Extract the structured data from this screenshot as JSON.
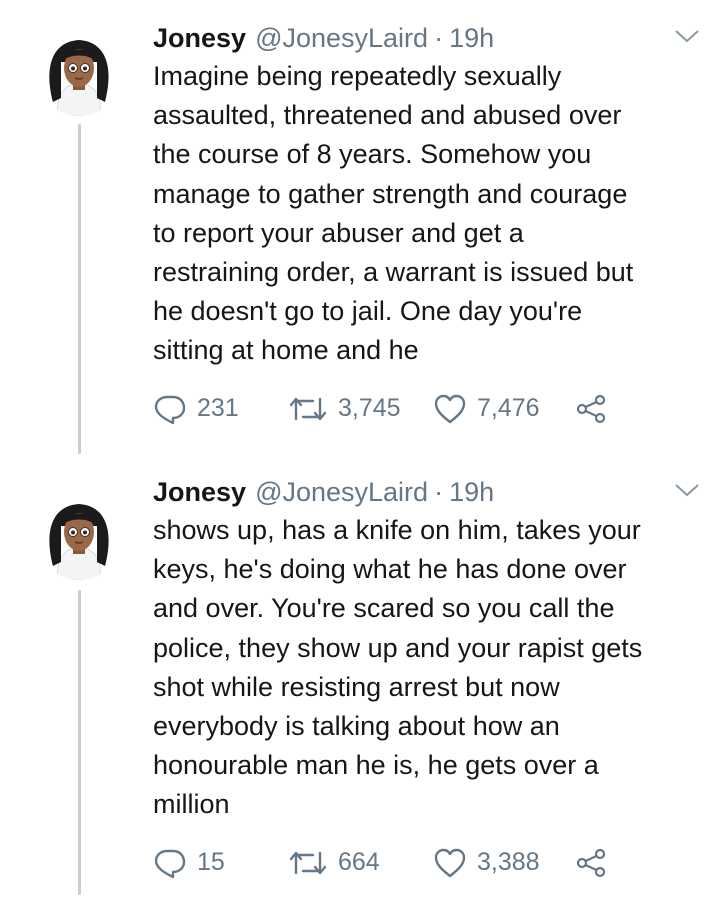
{
  "tweets": [
    {
      "name": "Jonesy",
      "handle": "@JonesyLaird",
      "separator": "·",
      "time": "19h",
      "lines": [
        "Imagine being repeatedly sexually",
        "assaulted, threatened and abused over",
        "the course of 8 years. Somehow you",
        "manage to gather strength and courage",
        "to report your abuser and get a",
        "restraining order, a warrant is issued but",
        "he doesn't go to jail. One day you're",
        "sitting at home and he"
      ],
      "replies": "231",
      "retweets": "3,745",
      "likes": "7,476"
    },
    {
      "name": "Jonesy",
      "handle": "@JonesyLaird",
      "separator": "·",
      "time": "19h",
      "lines": [
        "shows up, has a knife on him, takes your",
        "keys, he's doing what he has done over",
        "and over. You're scared so you call the",
        "police, they show up and your rapist gets",
        "shot while resisting arrest but now",
        "everybody is talking about how an",
        "honourable man he is, he gets over a",
        "million"
      ],
      "replies": "15",
      "retweets": "664",
      "likes": "3,388"
    }
  ],
  "icons": {
    "reply": "reply-icon",
    "retweet": "retweet-icon",
    "like": "heart-icon",
    "share": "share-icon",
    "caret": "chevron-down-icon"
  },
  "colors": {
    "text": "#14171a",
    "muted": "#657786",
    "thread_line": "#c4cfd6"
  }
}
